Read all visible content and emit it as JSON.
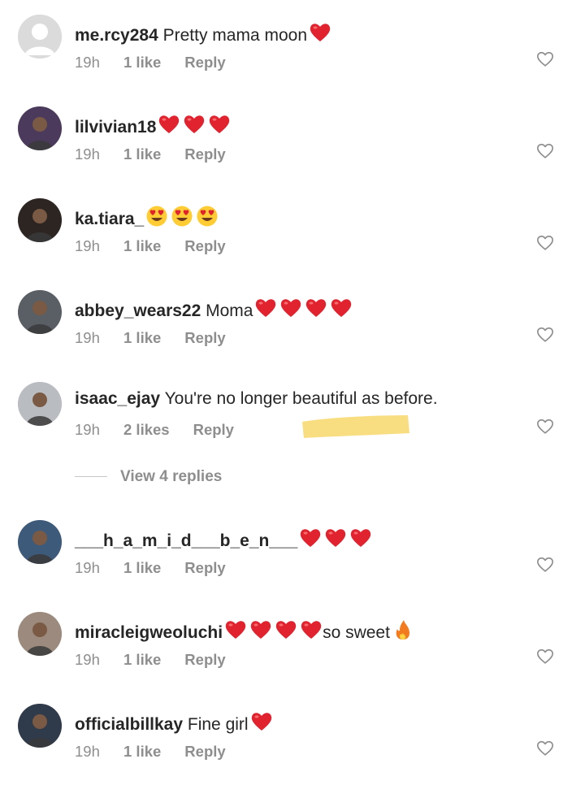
{
  "comments": [
    {
      "username": "me.rcy284",
      "text": "Pretty mama moon",
      "emojis": [
        "heart"
      ],
      "time": "19h",
      "likes": "1 like",
      "reply": "Reply",
      "avatar": "default"
    },
    {
      "username": "lilvivian18",
      "text": "",
      "emojis": [
        "heart",
        "heart",
        "heart"
      ],
      "time": "19h",
      "likes": "1 like",
      "reply": "Reply",
      "avatar": "photo"
    },
    {
      "username": "ka.tiara_",
      "text": "",
      "emojis": [
        "heart-eyes",
        "heart-eyes",
        "heart-eyes"
      ],
      "time": "19h",
      "likes": "1 like",
      "reply": "Reply",
      "avatar": "photo"
    },
    {
      "username": "abbey_wears22",
      "text": "Moma",
      "emojis": [
        "heart",
        "heart",
        "heart",
        "heart"
      ],
      "time": "19h",
      "likes": "1 like",
      "reply": "Reply",
      "avatar": "photo"
    },
    {
      "username": "isaac_ejay",
      "text": "You're no longer beautiful as before.",
      "emojis": [],
      "time": "19h",
      "likes": "2 likes",
      "reply": "Reply",
      "avatar": "photo"
    },
    {
      "username": "___h_a_m_i_d___b_e_n___",
      "text": "",
      "emojis": [
        "heart",
        "heart",
        "heart"
      ],
      "time": "19h",
      "likes": "1 like",
      "reply": "Reply",
      "avatar": "photo"
    },
    {
      "username": "miracleigweoluchi",
      "text": "",
      "emojis": [
        "heart",
        "heart",
        "heart",
        "heart"
      ],
      "text_after": "so sweet",
      "emojis_after": [
        "fire"
      ],
      "time": "19h",
      "likes": "1 like",
      "reply": "Reply",
      "avatar": "photo"
    },
    {
      "username": "officialbillkay",
      "text": "Fine girl",
      "emojis": [
        "heart"
      ],
      "time": "19h",
      "likes": "1 like",
      "reply": "Reply",
      "avatar": "photo"
    }
  ],
  "view_replies": "View 4 replies",
  "colors": {
    "text": "#262626",
    "meta": "#8e8e8e",
    "heart_emoji": "#e0232e",
    "highlight": "#f7d76b"
  }
}
